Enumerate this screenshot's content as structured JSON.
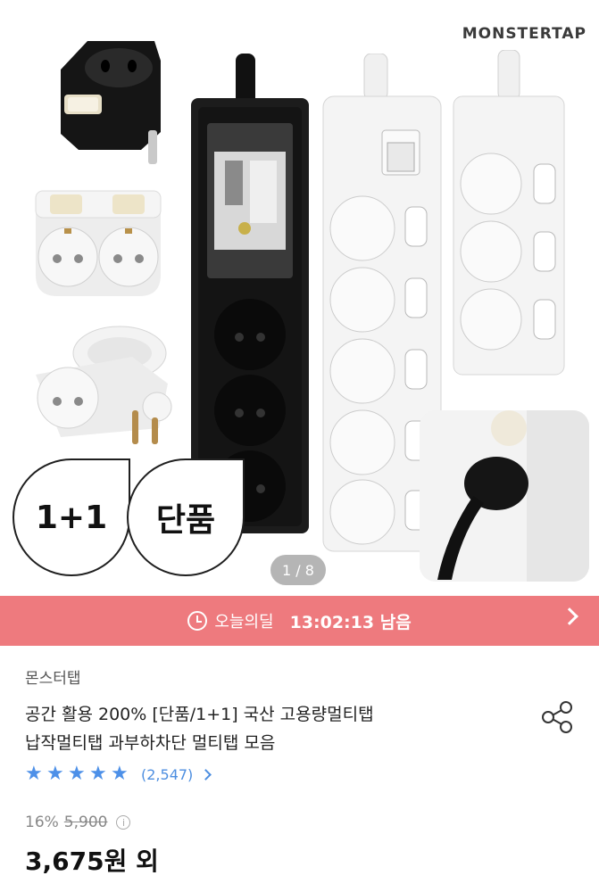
{
  "hero": {
    "brand": "MONSTERTAP",
    "badges": [
      "1+1",
      "단품"
    ],
    "image_counter": "1 / 8"
  },
  "deal": {
    "label": "오늘의딜",
    "time_left": "13:02:13 남음",
    "icon": "clock-icon",
    "color": "#ee7a7e"
  },
  "product": {
    "seller": "몬스터탭",
    "title_line1": "공간 활용 200% [단품/1+1] 국산 고용량멀티탭",
    "title_line2": "납작멀티탭 과부하차단 멀티탭 모음",
    "rating_stars": 5,
    "review_count": "(2,547)",
    "discount": "16%",
    "original_price": "5,900",
    "price": "3,675원 외"
  },
  "colors": {
    "star": "#4d90e8",
    "banner": "#ee7a7e"
  }
}
